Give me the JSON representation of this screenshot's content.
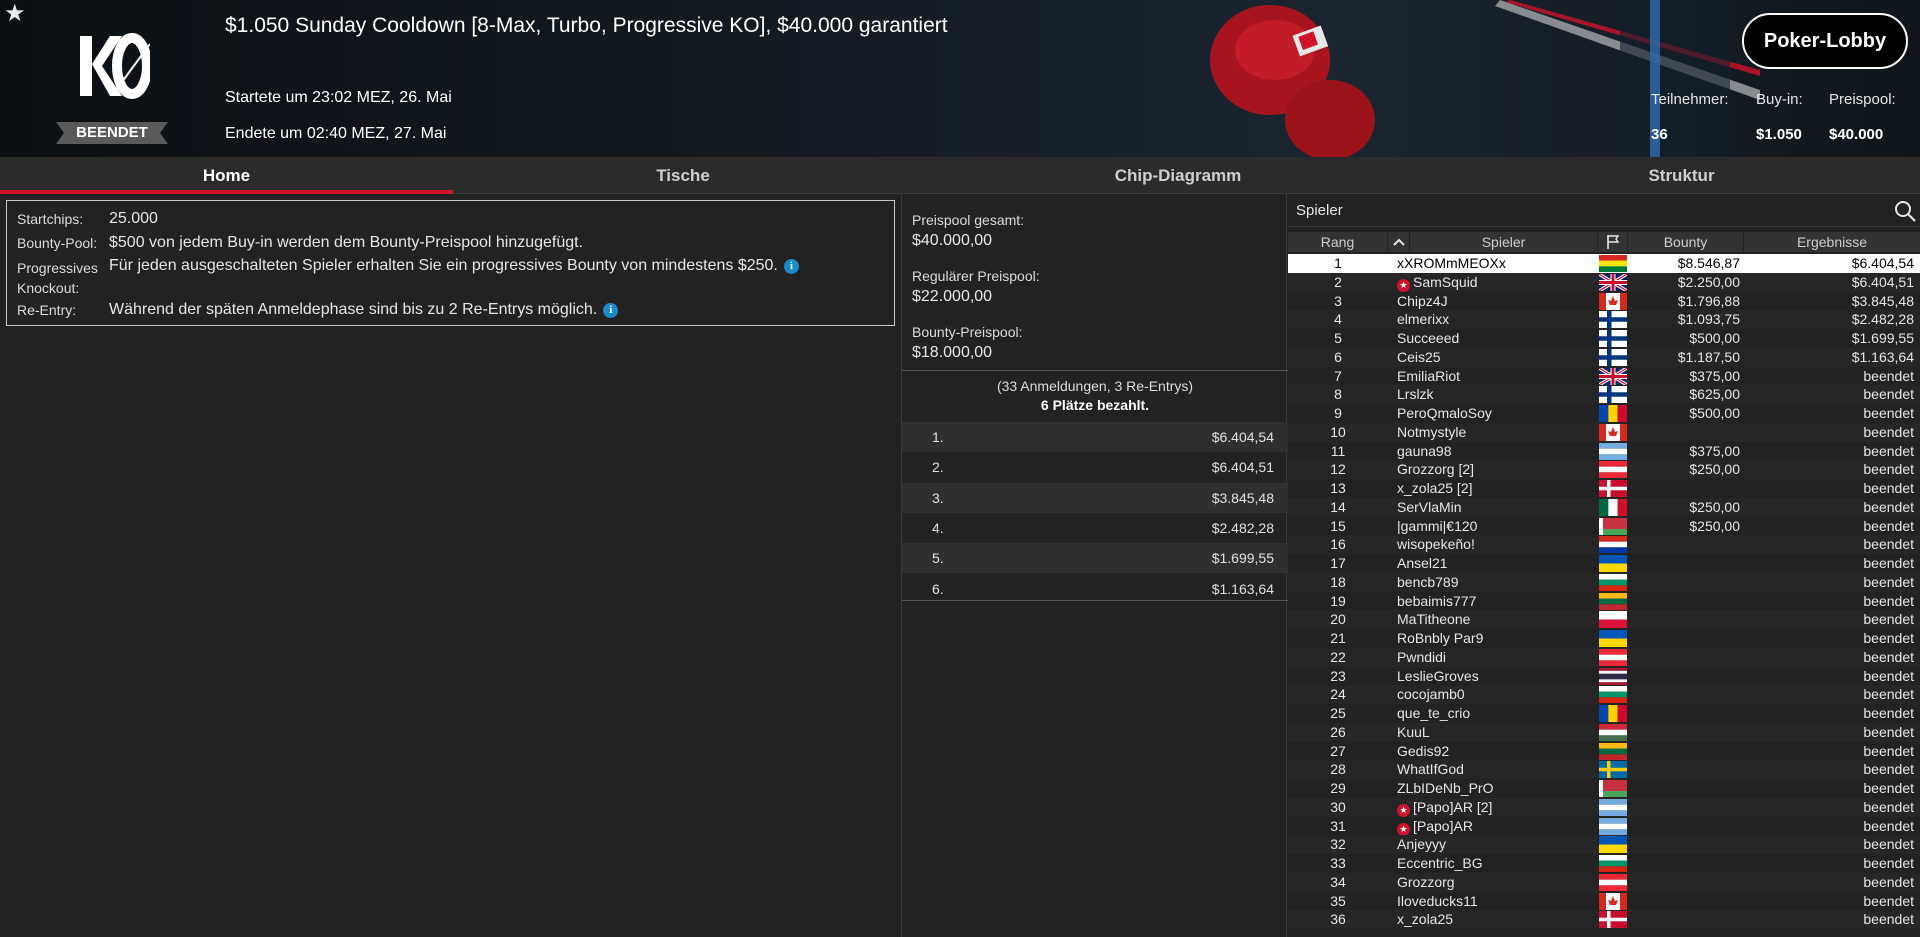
{
  "header": {
    "title": "$1.050 Sunday Cooldown [8-Max, Turbo, Progressive KO], $40.000 garantiert",
    "started": "Startete um 23:02 MEZ, 26. Mai",
    "ended": "Endete um 02:40 MEZ, 27. Mai",
    "status": "BEENDET",
    "logo_text": "KO",
    "lobby_button": "Poker-Lobby",
    "stats": {
      "participants_label": "Teilnehmer:",
      "participants_value": "36",
      "buyin_label": "Buy-in:",
      "buyin_value": "$1.050",
      "prizepool_label": "Preispool:",
      "prizepool_value": "$40.000"
    }
  },
  "tabs": [
    "Home",
    "Tische",
    "Chip-Diagramm",
    "Struktur"
  ],
  "info": {
    "startchips_label": "Startchips:",
    "startchips_value": "25.000",
    "bounty_label": "Bounty-Pool:",
    "bounty_value": "$500 von jedem Buy-in werden dem Bounty-Preispool hinzugefügt.",
    "pko_label": "Progressives Knockout:",
    "pko_value": "Für jeden ausgeschalteten Spieler erhalten Sie ein progressives Bounty von mindestens $250.",
    "reentry_label": "Re-Entry:",
    "reentry_value": "Während der späten Anmeldephase sind bis zu 2 Re-Entrys möglich.",
    "info_glyph": "i"
  },
  "pools": {
    "total_label": "Preispool gesamt:",
    "total_value": "$40.000,00",
    "regular_label": "Regulärer Preispool:",
    "regular_value": "$22.000,00",
    "bounty_label": "Bounty-Preispool:",
    "bounty_value": "$18.000,00",
    "entries_text": "(33 Anmeldungen, 3 Re-Entrys)",
    "paid_text": "6 Plätze bezahlt.",
    "payouts": [
      {
        "rank": "1.",
        "amount": "$6.404,54"
      },
      {
        "rank": "2.",
        "amount": "$6.404,51"
      },
      {
        "rank": "3.",
        "amount": "$3.845,48"
      },
      {
        "rank": "4.",
        "amount": "$2.482,28"
      },
      {
        "rank": "5.",
        "amount": "$1.699,55"
      },
      {
        "rank": "6.",
        "amount": "$1.163,64"
      }
    ]
  },
  "players": {
    "search_placeholder": "Spieler",
    "columns": {
      "rank": "Rang",
      "player": "Spieler",
      "bounty": "Bounty",
      "result": "Ergebnisse"
    },
    "rows": [
      {
        "rank": "1",
        "name": "xXROMmMEOXx",
        "bounty": "$8.546,87",
        "result": "$6.404,54",
        "flag": "bolivia"
      },
      {
        "rank": "2",
        "name": "SamSquid",
        "bounty": "$2.250,00",
        "result": "$6.404,51",
        "flag": "uk",
        "ps": true
      },
      {
        "rank": "3",
        "name": "Chipz4J",
        "bounty": "$1.796,88",
        "result": "$3.845,48",
        "flag": "canada"
      },
      {
        "rank": "4",
        "name": "elmerixx",
        "bounty": "$1.093,75",
        "result": "$2.482,28",
        "flag": "finland"
      },
      {
        "rank": "5",
        "name": "Succeeed",
        "bounty": "$500,00",
        "result": "$1.699,55",
        "flag": "finland"
      },
      {
        "rank": "6",
        "name": "Ceis25",
        "bounty": "$1.187,50",
        "result": "$1.163,64",
        "flag": "finland"
      },
      {
        "rank": "7",
        "name": "EmiliaRiot",
        "bounty": "$375,00",
        "result": "beendet",
        "flag": "uk"
      },
      {
        "rank": "8",
        "name": "Lrslzk",
        "bounty": "$625,00",
        "result": "beendet",
        "flag": "finland"
      },
      {
        "rank": "9",
        "name": "PeroQmaloSoy",
        "bounty": "$500,00",
        "result": "beendet",
        "flag": "moldova"
      },
      {
        "rank": "10",
        "name": "Notmystyle",
        "bounty": "",
        "result": "beendet",
        "flag": "canada"
      },
      {
        "rank": "11",
        "name": "gauna98",
        "bounty": "$375,00",
        "result": "beendet",
        "flag": "argentina"
      },
      {
        "rank": "12",
        "name": "Grozzorg [2]",
        "bounty": "$250,00",
        "result": "beendet",
        "flag": "austria"
      },
      {
        "rank": "13",
        "name": "x_zola25 [2]",
        "bounty": "",
        "result": "beendet",
        "flag": "denmark"
      },
      {
        "rank": "14",
        "name": "SerVlaMin",
        "bounty": "$250,00",
        "result": "beendet",
        "flag": "mexico"
      },
      {
        "rank": "15",
        "name": "|gammi|€120",
        "bounty": "$250,00",
        "result": "beendet",
        "flag": "belarus"
      },
      {
        "rank": "16",
        "name": "wisopekeño!",
        "bounty": "",
        "result": "beendet",
        "flag": "paraguay"
      },
      {
        "rank": "17",
        "name": "Ansel21",
        "bounty": "",
        "result": "beendet",
        "flag": "ukraine"
      },
      {
        "rank": "18",
        "name": "bencb789",
        "bounty": "",
        "result": "beendet",
        "flag": "bulgaria"
      },
      {
        "rank": "19",
        "name": "bebaimis777",
        "bounty": "",
        "result": "beendet",
        "flag": "lithuania"
      },
      {
        "rank": "20",
        "name": "MaTitheone",
        "bounty": "",
        "result": "beendet",
        "flag": "poland"
      },
      {
        "rank": "21",
        "name": "RoBnbly Par9",
        "bounty": "",
        "result": "beendet",
        "flag": "ukraine"
      },
      {
        "rank": "22",
        "name": "Pwndidi",
        "bounty": "",
        "result": "beendet",
        "flag": "austria"
      },
      {
        "rank": "23",
        "name": "LeslieGroves",
        "bounty": "",
        "result": "beendet",
        "flag": "thailand"
      },
      {
        "rank": "24",
        "name": "cocojamb0",
        "bounty": "",
        "result": "beendet",
        "flag": "bulgaria"
      },
      {
        "rank": "25",
        "name": "que_te_crio",
        "bounty": "",
        "result": "beendet",
        "flag": "moldova"
      },
      {
        "rank": "26",
        "name": "KuuL",
        "bounty": "",
        "result": "beendet",
        "flag": "hungary"
      },
      {
        "rank": "27",
        "name": "Gedis92",
        "bounty": "",
        "result": "beendet",
        "flag": "lithuania"
      },
      {
        "rank": "28",
        "name": "WhatIfGod",
        "bounty": "",
        "result": "beendet",
        "flag": "sweden"
      },
      {
        "rank": "29",
        "name": "ZLbIDeNb_PrO",
        "bounty": "",
        "result": "beendet",
        "flag": "belarus"
      },
      {
        "rank": "30",
        "name": "[Papo]AR [2]",
        "bounty": "",
        "result": "beendet",
        "flag": "argentina",
        "ps": true
      },
      {
        "rank": "31",
        "name": "[Papo]AR",
        "bounty": "",
        "result": "beendet",
        "flag": "argentina",
        "ps": true
      },
      {
        "rank": "32",
        "name": "Anjeyyy",
        "bounty": "",
        "result": "beendet",
        "flag": "ukraine"
      },
      {
        "rank": "33",
        "name": "Eccentric_BG",
        "bounty": "",
        "result": "beendet",
        "flag": "bulgaria"
      },
      {
        "rank": "34",
        "name": "Grozzorg",
        "bounty": "",
        "result": "beendet",
        "flag": "austria"
      },
      {
        "rank": "35",
        "name": "Iloveducks11",
        "bounty": "",
        "result": "beendet",
        "flag": "canada"
      },
      {
        "rank": "36",
        "name": "x_zola25",
        "bounty": "",
        "result": "beendet",
        "flag": "denmark"
      }
    ]
  },
  "colors": {
    "accent": "#d0122b",
    "info_icon": "#1a8bc8",
    "background": "#222222"
  },
  "icons": {
    "favorite": "star-icon",
    "search": "search-icon",
    "flag_column": "flag-icon",
    "sort": "sort-up-icon"
  }
}
